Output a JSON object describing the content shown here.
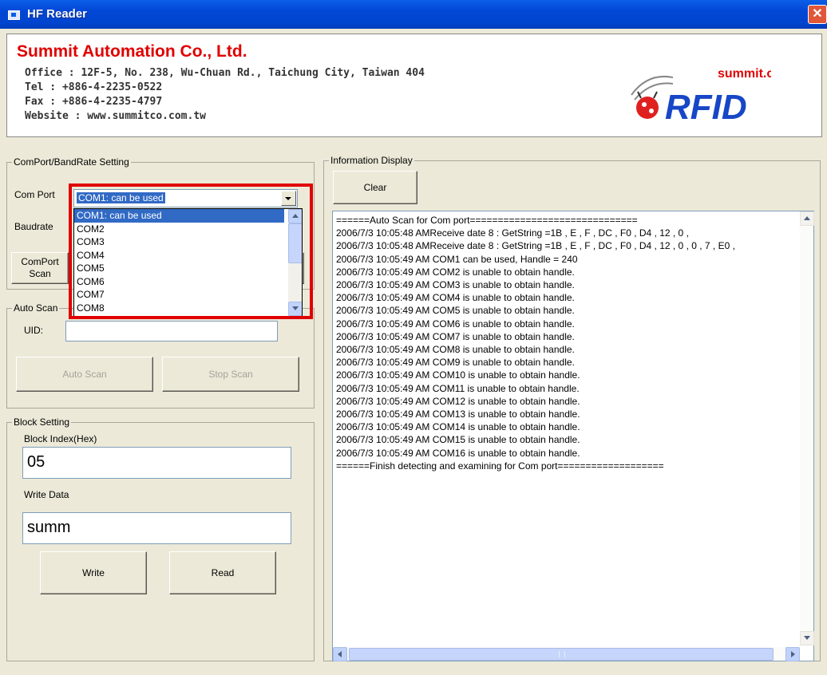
{
  "window": {
    "title": "HF Reader"
  },
  "header": {
    "company": "Summit Automation Co., Ltd.",
    "office": "Office : 12F-5, No. 238, Wu-Chuan Rd., Taichung City, Taiwan 404",
    "tel": "Tel : +886-4-2235-0522",
    "fax": "Fax : +886-4-2235-4797",
    "website": "Website : www.summitco.com.tw",
    "logo_small": "summit.co",
    "logo_big": "RFID"
  },
  "comport_group": {
    "legend": "ComPort/BandRate Setting",
    "com_port_label": "Com Port",
    "baudrate_label": "Baudrate",
    "scan_button": [
      "ComPort",
      "Scan"
    ],
    "selected_value": "COM1: can be used",
    "options": [
      "COM1: can be used",
      "COM2",
      "COM3",
      "COM4",
      "COM5",
      "COM6",
      "COM7",
      "COM8"
    ]
  },
  "autoscan_group": {
    "legend": "Auto Scan",
    "uid_label": "UID:",
    "uid_value": "",
    "auto_scan_button": "Auto Scan",
    "stop_scan_button": "Stop Scan"
  },
  "block_group": {
    "legend": "Block Setting",
    "index_label": "Block Index(Hex)",
    "index_value": "05",
    "write_label": "Write Data",
    "write_value": "summ",
    "write_button": "Write",
    "read_button": "Read"
  },
  "info_group": {
    "legend": "Information Display",
    "clear_button": "Clear",
    "log": [
      "======Auto Scan for Com port==============================",
      "2006/7/3 10:05:48 AMReceive date 8 : GetString =1B , E , F , DC , F0 , D4 , 12 , 0 ,",
      "2006/7/3 10:05:48 AMReceive date 8 : GetString =1B , E , F , DC , F0 , D4 , 12 , 0 , 0 , 7 , E0 ,",
      "2006/7/3 10:05:49 AM  COM1 can be used, Handle = 240",
      "2006/7/3 10:05:49 AM  COM2 is unable to obtain handle.",
      "2006/7/3 10:05:49 AM  COM3 is unable to obtain handle.",
      "2006/7/3 10:05:49 AM  COM4 is unable to obtain handle.",
      "2006/7/3 10:05:49 AM  COM5 is unable to obtain handle.",
      "2006/7/3 10:05:49 AM  COM6 is unable to obtain handle.",
      "2006/7/3 10:05:49 AM  COM7 is unable to obtain handle.",
      "2006/7/3 10:05:49 AM  COM8 is unable to obtain handle.",
      "2006/7/3 10:05:49 AM  COM9 is unable to obtain handle.",
      "2006/7/3 10:05:49 AM  COM10 is unable to obtain handle.",
      "2006/7/3 10:05:49 AM  COM11 is unable to obtain handle.",
      "2006/7/3 10:05:49 AM  COM12 is unable to obtain handle.",
      "2006/7/3 10:05:49 AM  COM13 is unable to obtain handle.",
      "2006/7/3 10:05:49 AM  COM14 is unable to obtain handle.",
      "2006/7/3 10:05:49 AM  COM15 is unable to obtain handle.",
      "2006/7/3 10:05:49 AM  COM16 is unable to obtain handle.",
      "======Finish detecting and examining for Com port==================="
    ]
  },
  "colors": {
    "brand_red": "#e00000",
    "selection_blue": "#316ac5",
    "titlebar_blue": "#0a5ee8"
  }
}
